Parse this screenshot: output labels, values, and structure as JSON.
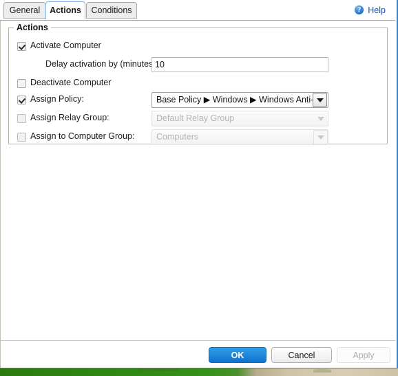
{
  "window": {
    "tabs": [
      {
        "id": "general",
        "label": "General",
        "selected": false
      },
      {
        "id": "actions",
        "label": "Actions",
        "selected": true
      },
      {
        "id": "conditions",
        "label": "Conditions",
        "selected": false
      }
    ],
    "help": {
      "label": "Help",
      "icon": "help-circle-icon",
      "color": "#1a4fa0"
    }
  },
  "actions_group": {
    "legend": "Actions",
    "activate": {
      "label": "Activate Computer",
      "checked": true,
      "delay_label": "Delay activation by (minutes):",
      "delay_value": "10"
    },
    "deactivate": {
      "label": "Deactivate Computer",
      "checked": false
    },
    "assign_policy": {
      "label": "Assign Policy:",
      "checked": true,
      "value": "Base Policy ▶ Windows ▶ Windows Anti-Mal",
      "enabled": true
    },
    "assign_relay_group": {
      "label": "Assign Relay Group:",
      "checked": false,
      "value": "Default Relay Group",
      "enabled": false
    },
    "assign_computer_group": {
      "label": "Assign to Computer Group:",
      "checked": false,
      "value": "Computers",
      "enabled": false
    }
  },
  "footer": {
    "ok": "OK",
    "cancel": "Cancel",
    "apply": "Apply",
    "ok_color": "#0f72cf"
  }
}
